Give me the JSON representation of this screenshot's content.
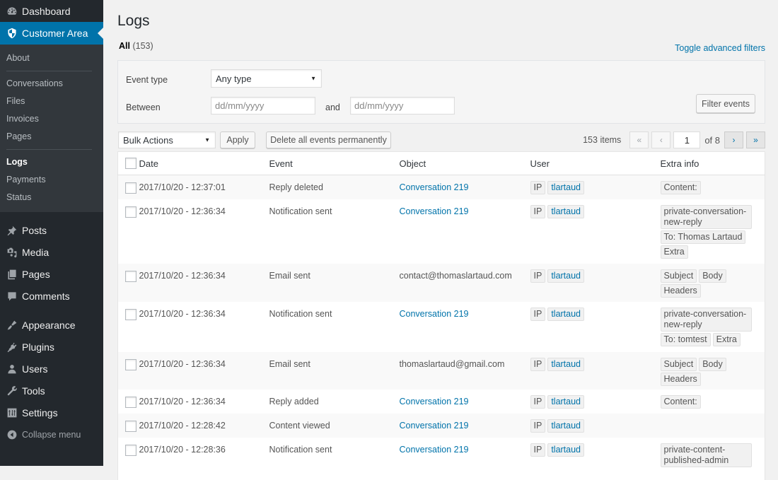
{
  "sidebar": {
    "top_items": [
      {
        "label": "Dashboard",
        "icon": "dashboard-icon"
      },
      {
        "label": "Customer Area",
        "icon": "shield-icon",
        "current": true
      }
    ],
    "submenu": [
      {
        "label": "About"
      },
      {
        "label": "Conversations"
      },
      {
        "label": "Files"
      },
      {
        "label": "Invoices"
      },
      {
        "label": "Pages"
      },
      {
        "label": "Logs",
        "current": true
      },
      {
        "label": "Payments"
      },
      {
        "label": "Status"
      }
    ],
    "group1": [
      {
        "label": "Posts",
        "icon": "pin-icon"
      },
      {
        "label": "Media",
        "icon": "media-icon"
      },
      {
        "label": "Pages",
        "icon": "pages-icon"
      },
      {
        "label": "Comments",
        "icon": "comment-icon"
      }
    ],
    "group2": [
      {
        "label": "Appearance",
        "icon": "brush-icon"
      },
      {
        "label": "Plugins",
        "icon": "plugin-icon"
      },
      {
        "label": "Users",
        "icon": "user-icon"
      },
      {
        "label": "Tools",
        "icon": "wrench-icon"
      },
      {
        "label": "Settings",
        "icon": "settings-icon"
      }
    ],
    "collapse_label": "Collapse menu"
  },
  "page": {
    "title": "Logs",
    "views_all_label": "All",
    "views_all_count": "(153)",
    "toggle_filters_label": "Toggle advanced filters"
  },
  "filters": {
    "event_type_label": "Event type",
    "event_type_value": "Any type",
    "between_label": "Between",
    "date_from_placeholder": "dd/mm/yyyy",
    "and_label": "and",
    "date_to_placeholder": "dd/mm/yyyy",
    "filter_button": "Filter events"
  },
  "tablenav": {
    "bulk_actions_value": "Bulk Actions",
    "apply_button": "Apply",
    "delete_all_button": "Delete all events permanently",
    "items_count": "153 items",
    "first_page": "«",
    "prev_page": "‹",
    "current_page": "1",
    "of_pages": "of 8",
    "next_page": "›",
    "last_page": "»"
  },
  "table": {
    "columns": [
      "Date",
      "Event",
      "Object",
      "User",
      "Extra info"
    ],
    "rows": [
      {
        "date": "2017/10/20 - 12:37:01",
        "event": "Reply deleted",
        "object": "Conversation 219",
        "object_link": true,
        "user_ip": "IP",
        "user_name": "tlartaud",
        "extra": [
          "Content:"
        ]
      },
      {
        "date": "2017/10/20 - 12:36:34",
        "event": "Notification sent",
        "object": "Conversation 219",
        "object_link": true,
        "user_ip": "IP",
        "user_name": "tlartaud",
        "extra": [
          "private-conversation-new-reply",
          "To: Thomas Lartaud",
          "Extra"
        ]
      },
      {
        "date": "2017/10/20 - 12:36:34",
        "event": "Email sent",
        "object": "contact@thomaslartaud.com",
        "object_link": false,
        "user_ip": "IP",
        "user_name": "tlartaud",
        "extra": [
          "Subject",
          "Body",
          "Headers"
        ]
      },
      {
        "date": "2017/10/20 - 12:36:34",
        "event": "Notification sent",
        "object": "Conversation 219",
        "object_link": true,
        "user_ip": "IP",
        "user_name": "tlartaud",
        "extra": [
          "private-conversation-new-reply",
          "To: tomtest",
          "Extra"
        ]
      },
      {
        "date": "2017/10/20 - 12:36:34",
        "event": "Email sent",
        "object": "thomaslartaud@gmail.com",
        "object_link": false,
        "user_ip": "IP",
        "user_name": "tlartaud",
        "extra": [
          "Subject",
          "Body",
          "Headers"
        ]
      },
      {
        "date": "2017/10/20 - 12:36:34",
        "event": "Reply added",
        "object": "Conversation 219",
        "object_link": true,
        "user_ip": "IP",
        "user_name": "tlartaud",
        "extra": [
          "Content:"
        ]
      },
      {
        "date": "2017/10/20 - 12:28:42",
        "event": "Content viewed",
        "object": "Conversation 219",
        "object_link": true,
        "user_ip": "IP",
        "user_name": "tlartaud",
        "extra": []
      },
      {
        "date": "2017/10/20 - 12:28:36",
        "event": "Notification sent",
        "object": "Conversation 219",
        "object_link": true,
        "user_ip": "IP",
        "user_name": "tlartaud",
        "extra": [
          "private-content-published-admin"
        ]
      }
    ]
  },
  "colors": {
    "sidebar_bg": "#23282d",
    "submenu_bg": "#32373c",
    "accent": "#0073aa",
    "page_bg": "#f1f1f1"
  }
}
